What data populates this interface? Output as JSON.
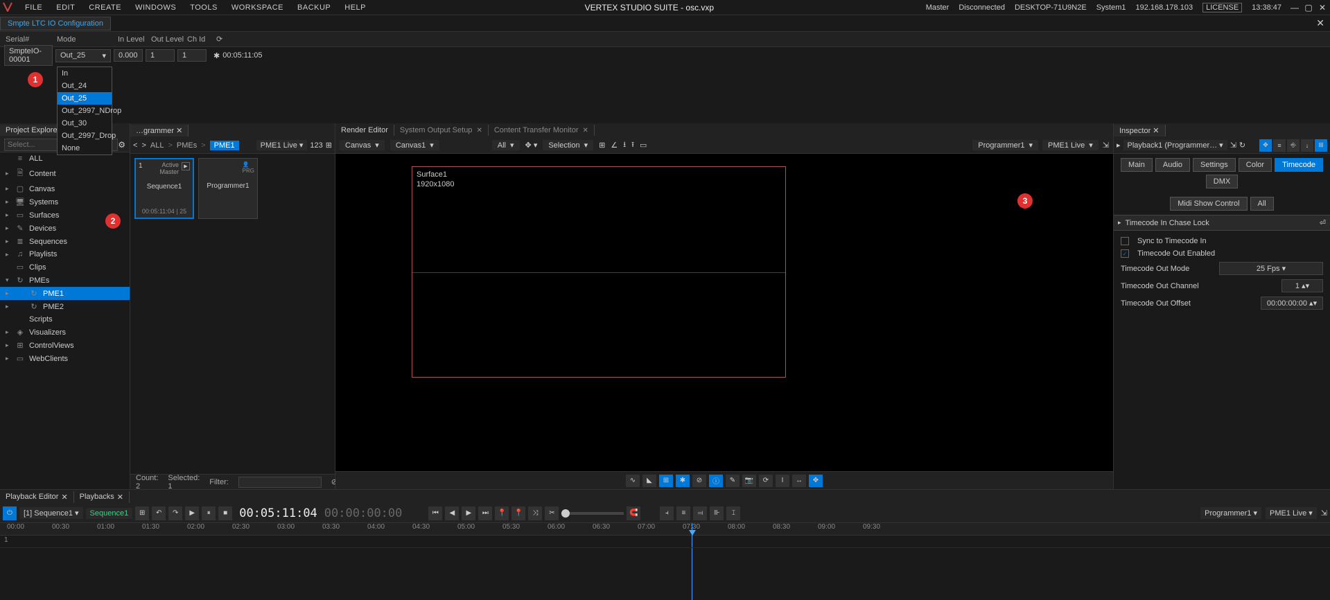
{
  "menubar": {
    "items": [
      "FILE",
      "EDIT",
      "CREATE",
      "WINDOWS",
      "TOOLS",
      "WORKSPACE",
      "BACKUP",
      "HELP"
    ],
    "title": "VERTEX STUDIO SUITE - osc.vxp",
    "status": {
      "role": "Master",
      "conn": "Disconnected",
      "host": "DESKTOP-71U9N2E",
      "system": "System1",
      "ip": "192.168.178.103",
      "license": "LICENSE",
      "time": "13:38:47"
    }
  },
  "configTab": {
    "label": "Smpte LTC IO Configuration"
  },
  "configHeaders": {
    "serial": "Serial#",
    "mode": "Mode",
    "inlevel": "In Level",
    "outlevel": "Out Level",
    "chid": "Ch Id"
  },
  "configRow": {
    "serial": "SmpteIO-00001",
    "mode": "Out_25",
    "inlevel": "0.000",
    "outlevel": "1",
    "chid": "1",
    "tc": "00:05:11:05"
  },
  "modeOptions": [
    "In",
    "Out_24",
    "Out_25",
    "Out_2997_NDrop",
    "Out_30",
    "Out_2997_Drop",
    "None"
  ],
  "modeSelected": "Out_25",
  "projectExplorer": {
    "title": "Project Explorer",
    "filterPlaceholder": "Select...",
    "items": [
      {
        "label": "ALL",
        "icon": "≡"
      },
      {
        "label": "Content",
        "icon": "🗎",
        "children": true
      },
      {
        "label": "Canvas",
        "icon": "▢",
        "children": true
      },
      {
        "label": "Systems",
        "icon": "🖥",
        "children": true
      },
      {
        "label": "Surfaces",
        "icon": "▭",
        "children": true
      },
      {
        "label": "Devices",
        "icon": "✎",
        "children": true
      },
      {
        "label": "Sequences",
        "icon": "≣",
        "children": true
      },
      {
        "label": "Playlists",
        "icon": "♫",
        "children": true
      },
      {
        "label": "Clips",
        "icon": "▭"
      },
      {
        "label": "PMEs",
        "icon": "↻",
        "children": true,
        "expanded": true,
        "sub": [
          {
            "label": "PME1",
            "selected": true
          },
          {
            "label": "PME2"
          }
        ]
      },
      {
        "label": "Scripts",
        "icon": "</>"
      },
      {
        "label": "Visualizers",
        "icon": "◈",
        "children": true
      },
      {
        "label": "ControlViews",
        "icon": "⊞",
        "children": true
      },
      {
        "label": "WebClients",
        "icon": "▭",
        "children": true
      }
    ]
  },
  "programmer": {
    "tab": "…grammer",
    "breadcrumb": {
      "all": "ALL",
      "pmes": "PMEs",
      "current": "PME1"
    },
    "layer": "PME1 Live",
    "cards": [
      {
        "num": "1",
        "role": "Active\nMaster",
        "name": "Sequence1",
        "tc": "00:05:11:04 | 25",
        "active": true
      },
      {
        "name": "Programmer1",
        "prg": true
      }
    ],
    "status": {
      "count": "Count: 2",
      "selected": "Selected: 1",
      "filterLabel": "Filter:"
    }
  },
  "render": {
    "tabs": [
      {
        "label": "Render Editor",
        "active": true
      },
      {
        "label": "System Output Setup",
        "closable": true
      },
      {
        "label": "Content Transfer Monitor",
        "closable": true
      }
    ],
    "toolbar": {
      "canvasLabel": "Canvas",
      "canvas": "Canvas1",
      "all": "All",
      "sel": "Selection",
      "programmer": "Programmer1",
      "layer": "PME1 Live"
    },
    "surface": {
      "name": "Surface1",
      "res": "1920x1080"
    }
  },
  "inspector": {
    "title": "Inspector",
    "target": "Playback1 (Programmer…",
    "tabs": [
      "Main",
      "Audio",
      "Settings",
      "Color",
      "Timecode",
      "DMX"
    ],
    "active": "Timecode",
    "sub": {
      "midi": "Midi Show Control",
      "all": "All"
    },
    "section": "Timecode In Chase Lock",
    "props": {
      "syncIn": {
        "label": "Sync to Timecode In",
        "checked": false
      },
      "outEnabled": {
        "label": "Timecode Out Enabled",
        "checked": true
      },
      "outMode": {
        "label": "Timecode Out Mode",
        "value": "25 Fps"
      },
      "outChannel": {
        "label": "Timecode Out Channel",
        "value": "1"
      },
      "outOffset": {
        "label": "Timecode Out Offset",
        "value": "00:00:00:00"
      }
    }
  },
  "playback": {
    "tabs": [
      {
        "label": "Playback Editor",
        "closable": true
      },
      {
        "label": "Playbacks",
        "closable": true
      }
    ],
    "seqLabel": "[1] Sequence1",
    "seqName": "Sequence1",
    "tcMain": "00:05:11:04",
    "tcSec": "00:00:00:00",
    "programmer": "Programmer1",
    "layer": "PME1 Live",
    "ruler": [
      "00:00",
      "00:30",
      "01:00",
      "01:30",
      "02:00",
      "02:30",
      "03:00",
      "03:30",
      "04:00",
      "04:30",
      "05:00",
      "05:30",
      "06:00",
      "06:30",
      "07:00",
      "07:30",
      "08:00",
      "08:30",
      "09:00",
      "09:30"
    ],
    "track1": "1"
  },
  "badges": {
    "1": "1",
    "2": "2",
    "3": "3"
  }
}
